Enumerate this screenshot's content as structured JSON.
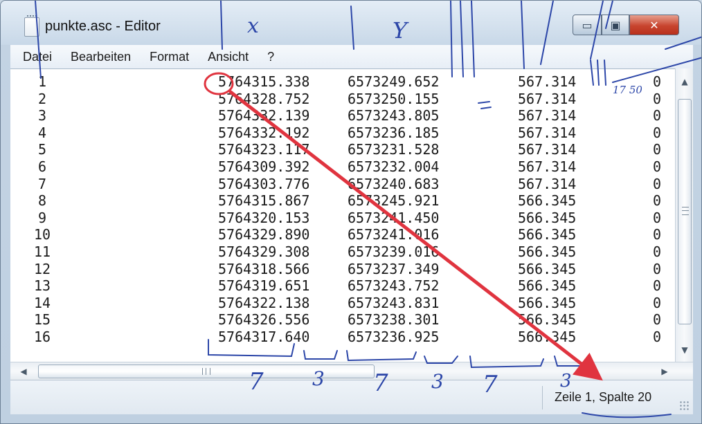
{
  "window": {
    "title": "punkte.asc - Editor",
    "icon": "notepad-document-icon",
    "controls": {
      "minimize_icon": "minimize-icon",
      "maximize_icon": "maximize-icon",
      "close_icon": "close-icon",
      "minimize_glyph": "▭",
      "maximize_glyph": "▣",
      "close_glyph": "✕"
    }
  },
  "menu": {
    "items": [
      "Datei",
      "Bearbeiten",
      "Format",
      "Ansicht",
      "?"
    ]
  },
  "editor": {
    "rows": [
      [
        "1",
        "5764315.338",
        "6573249.652",
        "567.314",
        "0"
      ],
      [
        "2",
        "5764328.752",
        "6573250.155",
        "567.314",
        "0"
      ],
      [
        "3",
        "5764332.139",
        "6573243.805",
        "567.314",
        "0"
      ],
      [
        "4",
        "5764332.192",
        "6573236.185",
        "567.314",
        "0"
      ],
      [
        "5",
        "5764323.117",
        "6573231.528",
        "567.314",
        "0"
      ],
      [
        "6",
        "5764309.392",
        "6573232.004",
        "567.314",
        "0"
      ],
      [
        "7",
        "5764303.776",
        "6573240.683",
        "567.314",
        "0"
      ],
      [
        "8",
        "5764315.867",
        "6573245.921",
        "566.345",
        "0"
      ],
      [
        "9",
        "5764320.153",
        "6573241.450",
        "566.345",
        "0"
      ],
      [
        "10",
        "5764329.890",
        "6573241.016",
        "566.345",
        "0"
      ],
      [
        "11",
        "5764329.308",
        "6573239.016",
        "566.345",
        "0"
      ],
      [
        "12",
        "5764318.566",
        "6573237.349",
        "566.345",
        "0"
      ],
      [
        "13",
        "5764319.651",
        "6573243.752",
        "566.345",
        "0"
      ],
      [
        "14",
        "5764322.138",
        "6573243.831",
        "566.345",
        "0"
      ],
      [
        "15",
        "5764326.556",
        "6573238.301",
        "566.345",
        "0"
      ],
      [
        "16",
        "5764317.640",
        "6573236.925",
        "566.345",
        "0"
      ]
    ]
  },
  "scrollbars": {
    "up_icon": "scroll-up-arrow-icon",
    "down_icon": "scroll-down-arrow-icon",
    "left_icon": "scroll-left-arrow-icon",
    "right_icon": "scroll-right-arrow-icon",
    "up_glyph": "▲",
    "down_glyph": "▼",
    "left_glyph": "◀",
    "right_glyph": "▶"
  },
  "status": {
    "position": "Zeile 1, Spalte 20"
  },
  "annotations": {
    "ink_color": "#2c46a8",
    "marker_color": "#e0343f",
    "labels": {
      "x": "x",
      "y": "Y",
      "width_a": "7",
      "width_b": "3",
      "width_c": "7",
      "width_d": "3",
      "width_e": "7",
      "width_f": "3",
      "side_note": "17 50"
    }
  }
}
